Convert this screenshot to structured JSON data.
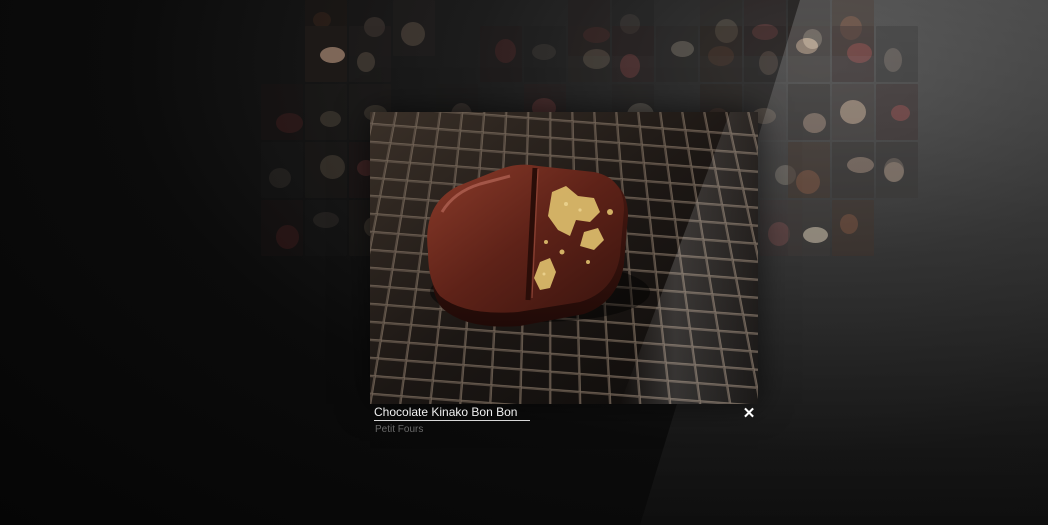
{
  "viewer": {
    "photo_icon": "chocolate-bonbon-photo",
    "title": "Chocolate Kinako Bon Bon",
    "category": "Petit Fours",
    "close_label": "✕"
  },
  "gallery": {
    "thumbnail_count": 46
  },
  "colors": {
    "background": "#060606",
    "caption_text": "#f0f0f0",
    "category_text": "#6a6a6a",
    "chocolate": "#6b2a1e",
    "gold_leaf": "#d9b96a"
  }
}
